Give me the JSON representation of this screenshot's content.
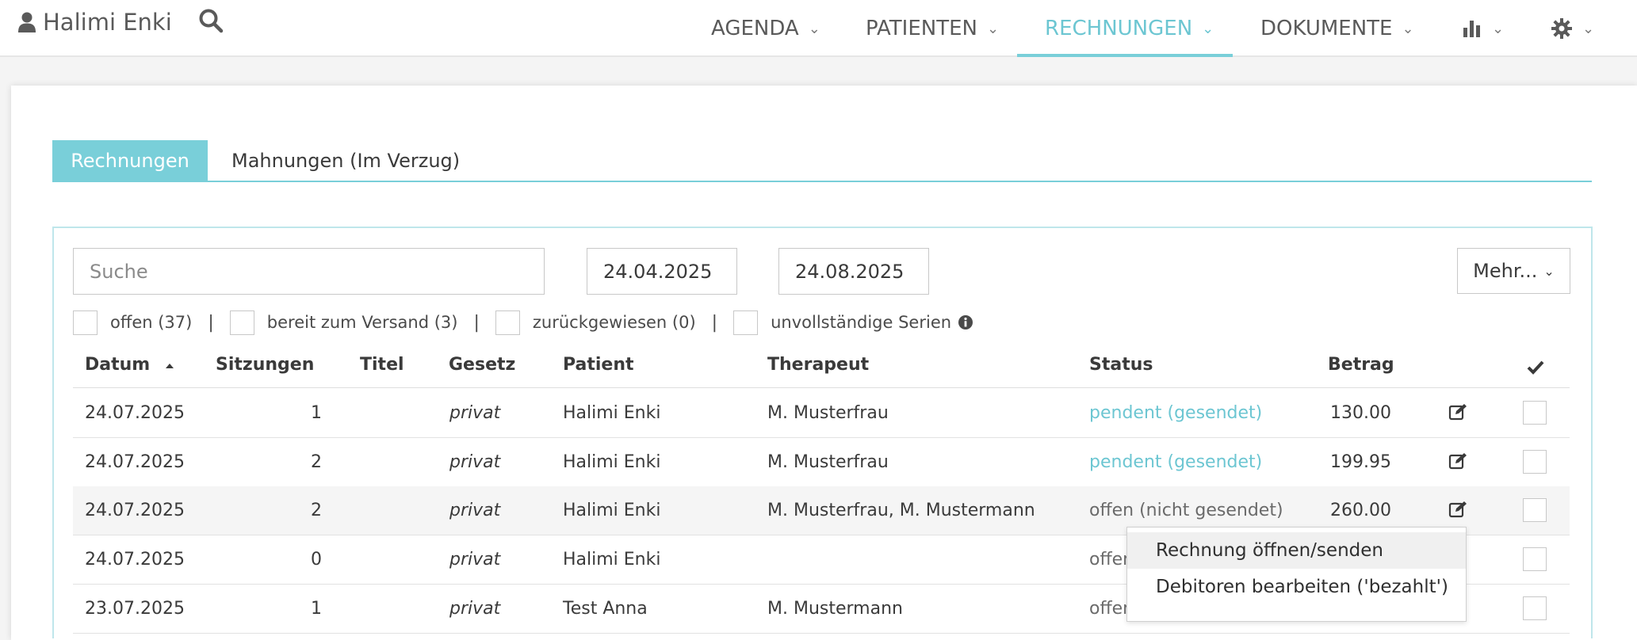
{
  "user": {
    "name": "Halimi Enki"
  },
  "nav": {
    "items": [
      {
        "label": "AGENDA"
      },
      {
        "label": "PATIENTEN"
      },
      {
        "label": "RECHNUNGEN"
      },
      {
        "label": "DOKUMENTE"
      }
    ],
    "active": "RECHNUNGEN",
    "icons": [
      "user-icon",
      "search-icon",
      "bar-chart-icon",
      "gear-icon",
      "chevron-down-icon"
    ]
  },
  "tabs": [
    {
      "label": "Rechnungen",
      "active": true
    },
    {
      "label": "Mahnungen (Im Verzug)",
      "active": false
    }
  ],
  "filters": {
    "search_placeholder": "Suche",
    "date_from": "24.04.2025",
    "date_to": "24.08.2025",
    "more_label": "Mehr...",
    "checkboxes": [
      {
        "label": "offen (37)"
      },
      {
        "label": "bereit zum Versand (3)"
      },
      {
        "label": "zurückgewiesen (0)"
      },
      {
        "label": "unvollständige Serien"
      }
    ],
    "separator": "|"
  },
  "table": {
    "headers": {
      "datum": "Datum",
      "sitzungen": "Sitzungen",
      "titel": "Titel",
      "gesetz": "Gesetz",
      "patient": "Patient",
      "therapeut": "Therapeut",
      "status": "Status",
      "betrag": "Betrag"
    },
    "sort": {
      "column": "Datum",
      "direction": "ascending"
    },
    "rows": [
      {
        "datum": "24.07.2025",
        "sitzungen": "1",
        "titel": "",
        "gesetz": "privat",
        "patient": "Halimi Enki",
        "therapeut": "M. Musterfrau",
        "status": "pendent (gesendet)",
        "betrag": "130.00"
      },
      {
        "datum": "24.07.2025",
        "sitzungen": "2",
        "titel": "",
        "gesetz": "privat",
        "patient": "Halimi Enki",
        "therapeut": "M. Musterfrau",
        "status": "pendent (gesendet)",
        "betrag": "199.95"
      },
      {
        "datum": "24.07.2025",
        "sitzungen": "2",
        "titel": "",
        "gesetz": "privat",
        "patient": "Halimi Enki",
        "therapeut": "M. Musterfrau, M. Mustermann",
        "status": "offen (nicht gesendet)",
        "betrag": "260.00"
      },
      {
        "datum": "24.07.2025",
        "sitzungen": "0",
        "titel": "",
        "gesetz": "privat",
        "patient": "Halimi Enki",
        "therapeut": "",
        "status": "offen",
        "betrag": ""
      },
      {
        "datum": "23.07.2025",
        "sitzungen": "1",
        "titel": "",
        "gesetz": "privat",
        "patient": "Test Anna",
        "therapeut": "M. Mustermann",
        "status": "offen",
        "betrag": ""
      }
    ]
  },
  "context_menu": {
    "items": [
      {
        "label": "Rechnung öffnen/senden"
      },
      {
        "label": "Debitoren bearbeiten ('bezahlt')"
      }
    ]
  },
  "colors": {
    "accent": "#79cfd9",
    "pending_status": "#6cc6d2"
  }
}
